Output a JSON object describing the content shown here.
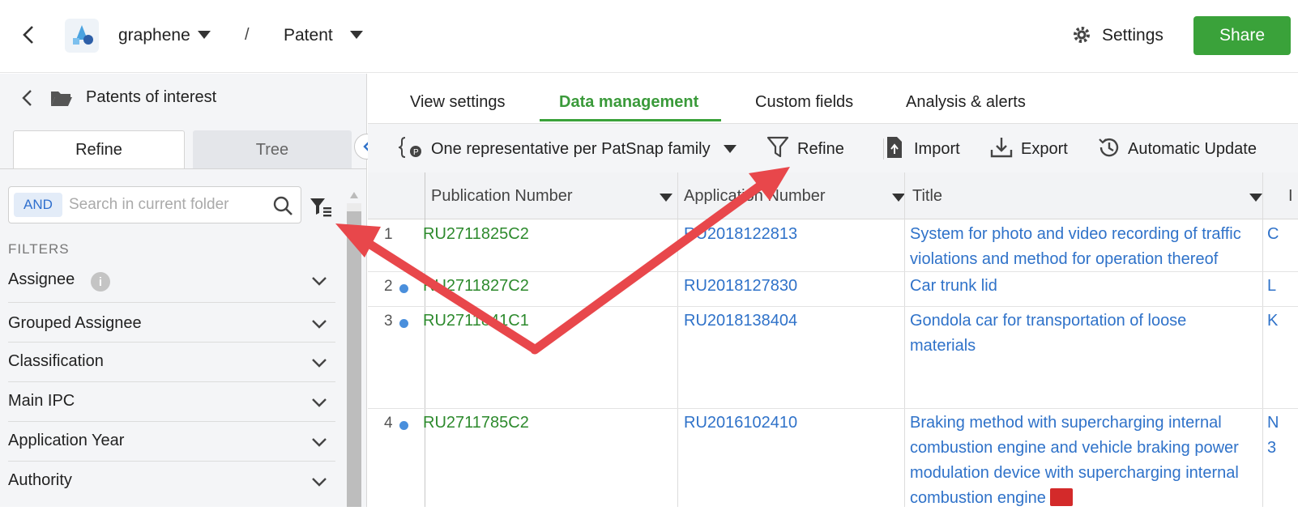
{
  "topbar": {
    "workspace": "graphene",
    "separator": "/",
    "section": "Patent",
    "settings_label": "Settings",
    "share_label": "Share"
  },
  "sidebar": {
    "title": "Patents of interest",
    "tabs": {
      "refine": "Refine",
      "tree": "Tree"
    },
    "search": {
      "operator": "AND",
      "placeholder": "Search in current folder"
    },
    "filters_heading": "FILTERS",
    "filters": [
      {
        "label": "Assignee"
      },
      {
        "label": "Grouped Assignee"
      },
      {
        "label": "Classification"
      },
      {
        "label": "Main IPC"
      },
      {
        "label": "Application Year"
      },
      {
        "label": "Authority"
      }
    ],
    "info_icon": "i"
  },
  "main": {
    "tabs": [
      "View settings",
      "Data management",
      "Custom fields",
      "Analysis & alerts"
    ],
    "active_tab": "Data management",
    "toolbar": {
      "family_mode": "One representative per PatSnap family",
      "refine": "Refine",
      "import": "Import",
      "export": "Export",
      "auto_update": "Automatic Update"
    },
    "columns": [
      "Publication Number",
      "Application Number",
      "Title"
    ],
    "rows": [
      {
        "n": "1",
        "pub": "RU2711825C2",
        "app": "RU2018122813",
        "title_l1": "System for photo and video recording of traffic",
        "title_l2": "violations and method for operation thereof",
        "title_l3": "",
        "title_l4": "",
        "extra": "C"
      },
      {
        "n": "2",
        "pub": "RU2711827C2",
        "app": "RU2018127830",
        "title_l1": "Car trunk lid",
        "title_l2": "",
        "title_l3": "",
        "title_l4": "",
        "extra": "L"
      },
      {
        "n": "3",
        "pub": "RU2711841C1",
        "app": "RU2018138404",
        "title_l1": "Gondola car for transportation of loose",
        "title_l2": "materials",
        "title_l3": "",
        "title_l4": "",
        "extra": "K"
      },
      {
        "n": "4",
        "pub": "RU2711785C2",
        "app": "RU2016102410",
        "title_l1": "Braking method with supercharging internal",
        "title_l2": "combustion engine and vehicle braking power",
        "title_l3": "modulation device with supercharging internal",
        "title_l4": "combustion engine",
        "extra": "N",
        "extra2": "3"
      }
    ]
  },
  "colors": {
    "accent": "#3aa23a",
    "link": "#2f72c9",
    "pubnum": "#2d8a2d",
    "arrow": "#e8474b"
  }
}
